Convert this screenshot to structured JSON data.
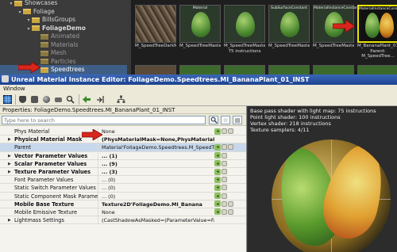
{
  "tree": {
    "items": [
      {
        "label": "Showcases",
        "indent": 0,
        "state": "normal"
      },
      {
        "label": "Foliage",
        "indent": 1,
        "state": "normal"
      },
      {
        "label": "BillsGroups",
        "indent": 2,
        "state": "normal"
      },
      {
        "label": "FoliageDemo",
        "indent": 2,
        "state": "bold"
      },
      {
        "label": "Animated",
        "indent": 3,
        "state": "dim"
      },
      {
        "label": "Materials",
        "indent": 3,
        "state": "dim"
      },
      {
        "label": "Mesh",
        "indent": 3,
        "state": "dim"
      },
      {
        "label": "Particles",
        "indent": 3,
        "state": "dim"
      },
      {
        "label": "Speedtrees",
        "indent": 3,
        "state": "selected"
      }
    ]
  },
  "thumbnails": [
    {
      "overlay": "",
      "caption": "M_SpeedTreeDarkMaster_01_INST",
      "kind": "bark"
    },
    {
      "overlay": "Material",
      "caption": "M_SpeedTreeMaster_01_INST",
      "kind": "leaf"
    },
    {
      "overlay": "",
      "caption": "M_SpeedTreeMaster_02_Wind 75 instructions",
      "kind": "leaf"
    },
    {
      "overlay": "SubSurfaceConstant",
      "caption": "M_SpeedTreeMaster_02_Wind_INST",
      "kind": "leaf"
    },
    {
      "overlay": "MaterialInstanceConstant",
      "caption": "M_SpeedTreeMaster_02_Wind_INST_Flattened",
      "kind": "leaf"
    },
    {
      "overlay": "MaterialInstanceConstant",
      "caption": "M_BananaPlant_01_INST Parent: M_SpeedTree...",
      "kind": "banana",
      "selected": true
    }
  ],
  "window": {
    "title": "Unreal Material Instance Editor: FoliageDemo.Speedtrees.MI_BananaPlant_01_INST",
    "menu": [
      "Window"
    ]
  },
  "properties": {
    "header": "Properties: FoliageDemo.Speedtrees.MI_BananaPlant_01_INST",
    "search_placeholder": "Type here to search",
    "rows": [
      {
        "name": "Phys Material",
        "value": "None",
        "bold": false,
        "expander": "",
        "buttons": [
          "g",
          "m",
          "m"
        ]
      },
      {
        "name": "Physical Material Mask",
        "value": "(PhysMaterialMask=None,PhysMaterialMaskUVC",
        "bold": true,
        "expander": "▶",
        "buttons": []
      },
      {
        "name": "Parent",
        "value": "Material'FoliageDemo.Speedtrees.M_SpeedTree",
        "bold": false,
        "expander": "",
        "buttons": [
          "g",
          "m",
          "m"
        ],
        "highlight": true
      },
      {
        "name": "Vector Parameter Values",
        "value": "... (1)",
        "bold": true,
        "expander": "▶",
        "buttons": [
          "g",
          "m"
        ]
      },
      {
        "name": "Scalar Parameter Values",
        "value": "... (9)",
        "bold": true,
        "expander": "▶",
        "buttons": [
          "g",
          "m"
        ]
      },
      {
        "name": "Texture Parameter Values",
        "value": "... (3)",
        "bold": true,
        "expander": "▶",
        "buttons": [
          "g",
          "m"
        ]
      },
      {
        "name": "Font Parameter Values",
        "value": "... (0)",
        "bold": false,
        "expander": "",
        "buttons": [
          "g",
          "m"
        ]
      },
      {
        "name": "Static Switch Parameter Values",
        "value": "... (0)",
        "bold": false,
        "expander": "",
        "buttons": [
          "g",
          "m"
        ]
      },
      {
        "name": "Static Component Mask Parameter V",
        "value": "... (0)",
        "bold": false,
        "expander": "",
        "buttons": [
          "g",
          "m"
        ]
      },
      {
        "name": "Mobile Base Texture",
        "value": "Texture2D'FoliageDemo.MI_Banana",
        "bold": true,
        "expander": "",
        "buttons": [
          "g",
          "m",
          "m"
        ]
      },
      {
        "name": "Mobile Emissive Texture",
        "value": "None",
        "bold": false,
        "expander": "",
        "buttons": [
          "g",
          "m",
          "m"
        ]
      },
      {
        "name": "Lightmass Settings",
        "value": "(CastShadowAsMasked=(ParameterValue=False,bOverr",
        "bold": false,
        "expander": "▶",
        "buttons": []
      }
    ]
  },
  "preview": {
    "stats": [
      "Base pass shader with light map: 75 instructions",
      "Point light shader: 100 instructions",
      "Vertex shader: 218 instructions",
      "Texture samplers: 4/11"
    ]
  },
  "colors": {
    "title_bar": "#1d4390",
    "selection": "#e8e400",
    "arrow": "#d8261c"
  }
}
